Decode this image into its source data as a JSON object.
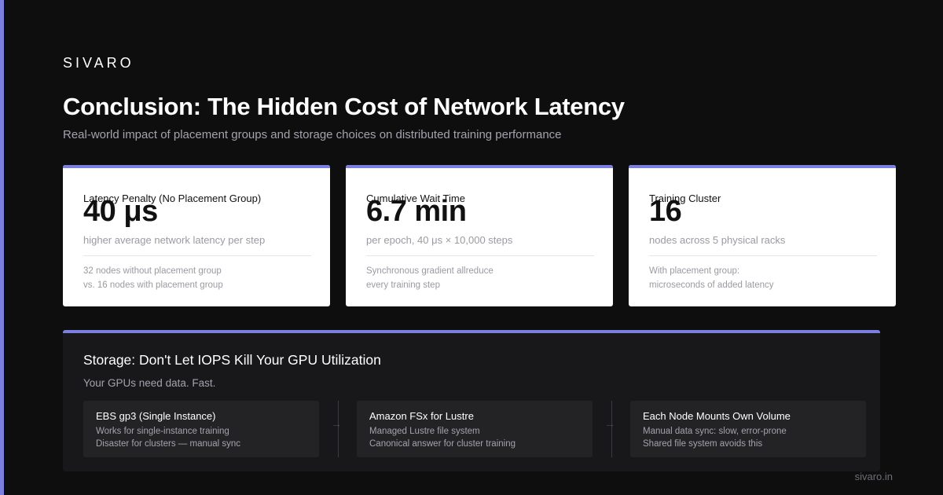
{
  "brand": "SIVARO",
  "title": "Conclusion: The Hidden Cost of Network Latency",
  "subtitle": "Real-world impact of placement groups and storage choices on distributed training performance",
  "colors": {
    "accent": "#7b7fe0",
    "background": "#0e0e0f",
    "card": "#ffffff",
    "panel": "#18181a"
  },
  "cards": [
    {
      "label": "Latency Penalty (No Placement Group)",
      "value": "40 μs",
      "desc": "higher average network latency per step",
      "note_1": "32 nodes without placement group",
      "note_2": "vs. 16 nodes with placement group"
    },
    {
      "label": "Cumulative Wait Time",
      "value": "6.7 min",
      "desc": "per epoch, 40 μs × 10,000 steps",
      "note_1": "Synchronous gradient allreduce",
      "note_2": "every training step"
    },
    {
      "label": "Training Cluster",
      "value": "16",
      "desc": "nodes across 5 physical racks",
      "note_1": "With placement group:",
      "note_2": "microseconds of added latency"
    }
  ],
  "storage": {
    "heading": "Storage: Don't Let IOPS Kill Your GPU Utilization",
    "lead": "Your GPUs need data. Fast.",
    "arrow_glyph": "→",
    "options": [
      {
        "title": "EBS gp3 (Single Instance)",
        "line_1": "Works for single-instance training",
        "line_2": "Disaster for clusters — manual sync"
      },
      {
        "title": "Amazon FSx for Lustre",
        "line_1": "Managed Lustre file system",
        "line_2": "Canonical answer for cluster training"
      },
      {
        "title": "Each Node Mounts Own Volume",
        "line_1": "Manual data sync: slow, error-prone",
        "line_2": "Shared file system avoids this"
      }
    ]
  },
  "footer": "sivaro.in"
}
